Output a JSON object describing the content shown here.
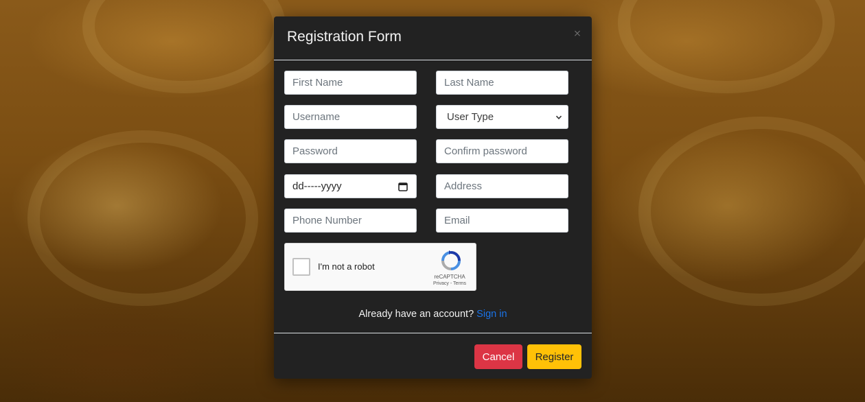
{
  "modal": {
    "title": "Registration Form",
    "close_symbol": "⨯"
  },
  "form": {
    "first_name": {
      "placeholder": "First Name",
      "value": ""
    },
    "last_name": {
      "placeholder": "Last Name",
      "value": ""
    },
    "username": {
      "placeholder": "Username",
      "value": ""
    },
    "user_type": {
      "selected": "User Type"
    },
    "password": {
      "placeholder": "Password",
      "value": ""
    },
    "confirm_password": {
      "placeholder": "Confirm password",
      "value": ""
    },
    "date_of_birth": {
      "placeholder": "dd-----yyyy"
    },
    "address": {
      "placeholder": "Address",
      "value": ""
    },
    "phone": {
      "placeholder": "Phone Number",
      "value": ""
    },
    "email": {
      "placeholder": "Email",
      "value": ""
    }
  },
  "captcha": {
    "label": "I'm not a robot",
    "brand": "reCAPTCHA",
    "privacy": "Privacy",
    "separator": " - ",
    "terms": "Terms"
  },
  "signin": {
    "prompt": "Already have an account?",
    "link": "Sign in"
  },
  "footer": {
    "cancel_label": "Cancel",
    "register_label": "Register"
  },
  "colors": {
    "modal_bg": "#222222",
    "cancel": "#dc3545",
    "register": "#ffc107",
    "link": "#1a73e8"
  },
  "icons": {
    "close": "close-icon",
    "select_arrow": "chevron-down-icon",
    "date": "calendar-icon",
    "captcha": "recaptcha-logo-icon"
  }
}
